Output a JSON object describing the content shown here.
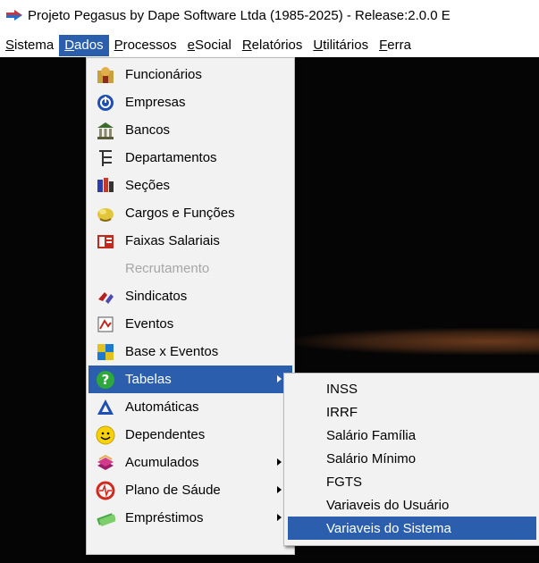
{
  "window": {
    "title": "Projeto Pegasus by Dape Software Ltda (1985-2025) - Release:2.0.0  E"
  },
  "menubar": {
    "items": [
      {
        "label": "Sistema"
      },
      {
        "label": "Dados",
        "active": true
      },
      {
        "label": "Processos"
      },
      {
        "label": "eSocial"
      },
      {
        "label": "Relatórios"
      },
      {
        "label": "Utilitários"
      },
      {
        "label": "Ferra"
      }
    ]
  },
  "dados_menu": {
    "items": [
      {
        "label": "Funcionários",
        "icon": "employee-icon"
      },
      {
        "label": "Empresas",
        "icon": "power-icon"
      },
      {
        "label": "Bancos",
        "icon": "bank-icon"
      },
      {
        "label": "Departamentos",
        "icon": "org-chart-icon"
      },
      {
        "label": "Seções",
        "icon": "sections-icon"
      },
      {
        "label": "Cargos e Funções",
        "icon": "roles-icon"
      },
      {
        "label": "Faixas Salariais",
        "icon": "salary-range-icon"
      },
      {
        "label": "Recrutamento",
        "icon": "",
        "disabled": true
      },
      {
        "label": "Sindicatos",
        "icon": "union-icon"
      },
      {
        "label": "Eventos",
        "icon": "events-icon"
      },
      {
        "label": "Base x Eventos",
        "icon": "base-events-icon"
      },
      {
        "label": "Tabelas",
        "icon": "help-icon",
        "highlighted": true,
        "submenu": true
      },
      {
        "label": "Automáticas",
        "icon": "automatic-icon"
      },
      {
        "label": "Dependentes",
        "icon": "smiley-icon"
      },
      {
        "label": "Acumulados",
        "icon": "accumulated-icon",
        "submenu": true
      },
      {
        "label": "Plano de Sáude",
        "icon": "health-plan-icon",
        "submenu": true
      },
      {
        "label": "Empréstimos",
        "icon": "loan-icon",
        "submenu": true
      }
    ]
  },
  "tabelas_submenu": {
    "items": [
      {
        "label": "INSS"
      },
      {
        "label": "IRRF"
      },
      {
        "label": "Salário Família"
      },
      {
        "label": "Salário Mínimo"
      },
      {
        "label": "FGTS"
      },
      {
        "label": "Variaveis do Usuário"
      },
      {
        "label": "Variaveis do Sistema",
        "highlighted": true
      }
    ]
  },
  "colors": {
    "highlight": "#2b5fad",
    "menu_background": "#f2f2f2",
    "workspace": "#050505",
    "disabled_text": "#a6a6a6"
  }
}
